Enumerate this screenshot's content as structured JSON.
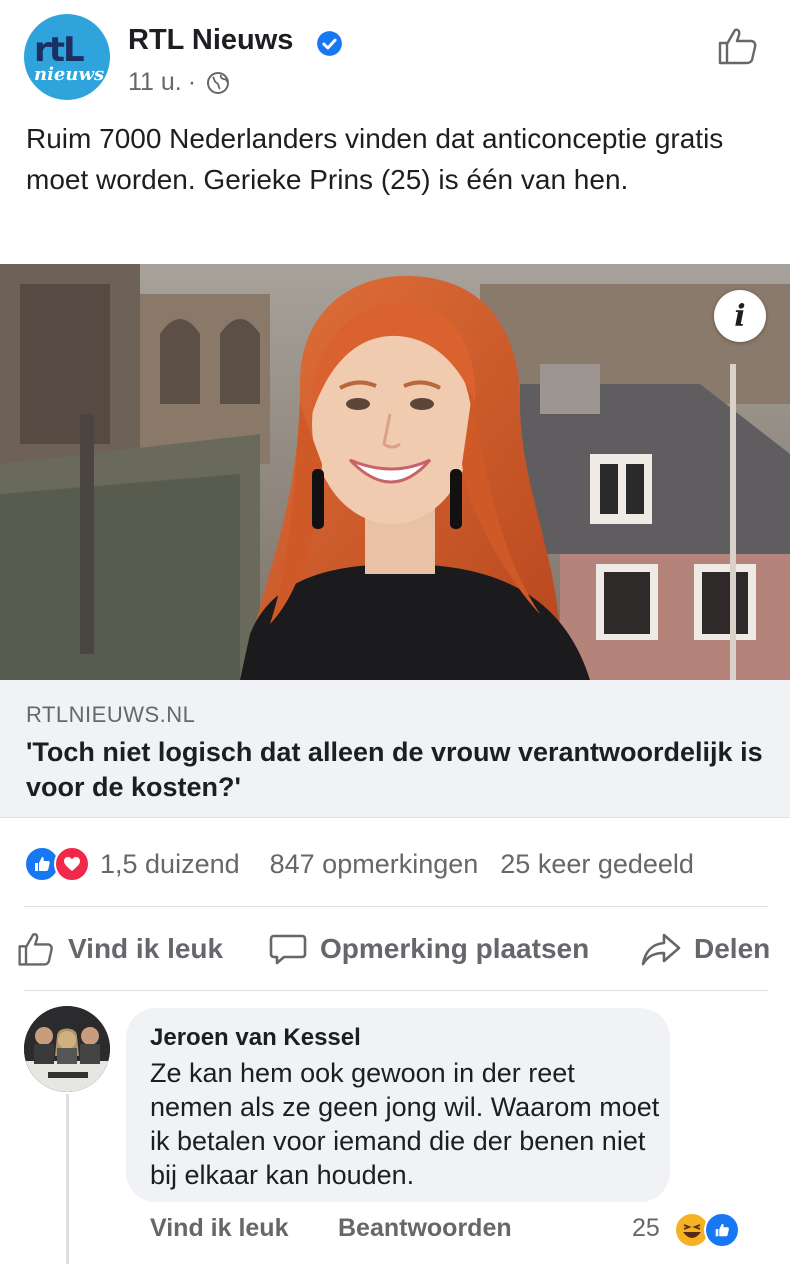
{
  "post": {
    "page_name": "RTL Nieuws",
    "time": "11 u.",
    "separator": "·",
    "avatar": {
      "line1": "rtL",
      "line2": "nieuws"
    },
    "caption": "Ruim 7000 Nederlanders vinden dat anticonceptie gratis moet worden. Gerieke Prins (25) is één van hen.",
    "icons": {
      "verified": "verified-badge-icon",
      "privacy": "globe-icon",
      "like_page": "thumbs-up-icon",
      "info": "info-icon"
    }
  },
  "photo": {
    "info_label": "i"
  },
  "link": {
    "domain": "RTLNIEUWS.NL",
    "title": "'Toch niet logisch dat alleen de vrouw verantwoordelijk is voor de kosten?'"
  },
  "stats": {
    "reactions": "1,5 duizend",
    "comments": "847 opmerkingen",
    "shares": "25 keer gedeeld"
  },
  "actions": {
    "like": "Vind ik leuk",
    "comment": "Opmerking plaatsen",
    "share": "Delen"
  },
  "comment": {
    "author": "Jeroen van Kessel",
    "text": "Ze kan hem ook gewoon in der reet nemen als ze geen jong wil. Waarom moet ik betalen voor iemand die der benen niet bij elkaar kan houden.",
    "like": "Vind ik leuk",
    "reply": "Beantwoorden",
    "reaction_count": "25"
  },
  "colors": {
    "accent": "#1877f2",
    "love": "#f02849",
    "haha": "#f7b125",
    "rtl_blue": "#2fa4dc",
    "muted_text": "#65676b"
  }
}
